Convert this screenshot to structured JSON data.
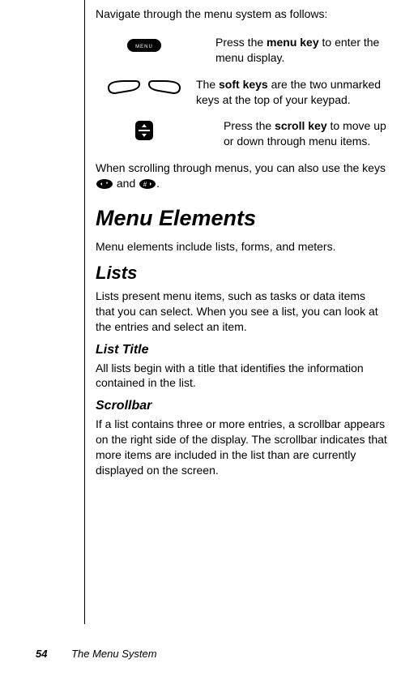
{
  "intro": "Navigate through the menu system as follows:",
  "rows": {
    "menu_key": {
      "pre": "Press the ",
      "b": "menu key",
      "post": " to enter the menu display."
    },
    "soft_keys": {
      "pre": "The ",
      "b": "soft keys",
      "post": " are the two unmarked keys at the top of your keypad."
    },
    "scroll_key": {
      "pre": "Press the ",
      "b": "scroll key",
      "post": " to move up or down through menu items."
    }
  },
  "scroll_note": {
    "pre": "When scrolling through menus, you can also use the keys ",
    "mid": " and ",
    "post": "."
  },
  "h1": "Menu Elements",
  "menu_elements_para": "Menu elements include lists, forms, and meters.",
  "h2_lists": "Lists",
  "lists_para": "Lists present menu items, such as tasks or data items that you can select. When you see a list, you can look at the entries and select an item.",
  "h3_list_title": "List Title",
  "list_title_para": "All lists begin with a title that identifies the information contained in the list.",
  "h3_scrollbar": "Scrollbar",
  "scrollbar_para": "If a list contains three or more entries, a scrollbar appears on the right side of the display. The scrollbar indicates that more items are included in the list than are currently displayed on the screen.",
  "footer": {
    "page": "54",
    "chapter": "The Menu System"
  }
}
